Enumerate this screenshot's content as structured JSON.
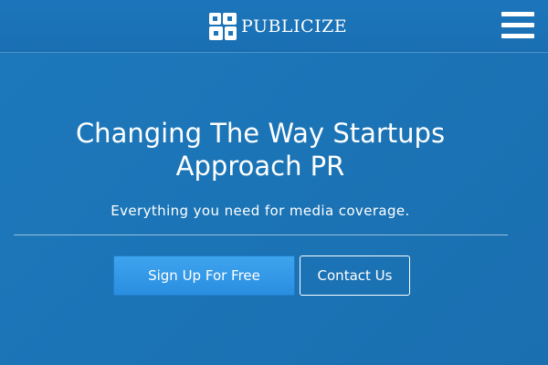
{
  "header": {
    "brand": "Publicize",
    "logo_icon": "publicize-logo-icon",
    "menu_icon": "hamburger-menu-icon"
  },
  "hero": {
    "headline_line1": "Changing The Way Startups",
    "headline_line2": "Approach PR",
    "tagline": "Everything you need for media coverage."
  },
  "actions": {
    "signup_label": "Sign Up For Free",
    "contact_label": "Contact Us"
  },
  "colors": {
    "background": "#1b73b8",
    "signup_button": "#3399e8",
    "text": "#ffffff"
  }
}
